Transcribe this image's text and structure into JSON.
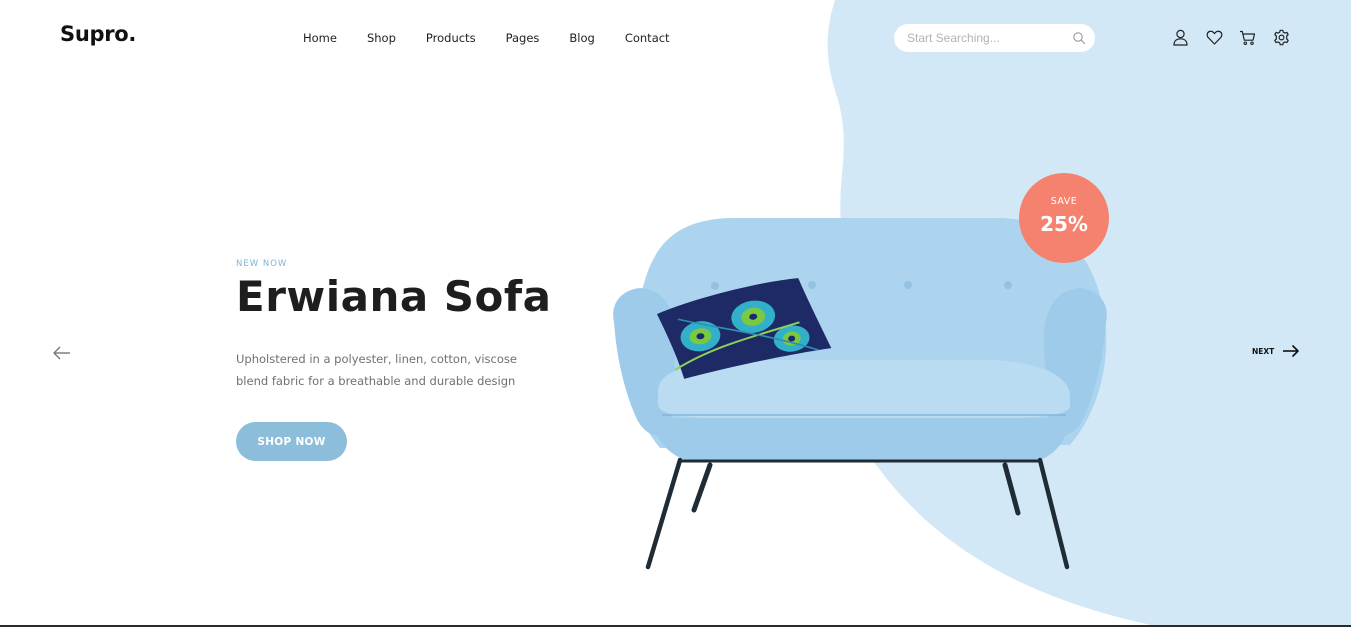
{
  "brand": {
    "logo": "Supro."
  },
  "nav": [
    "Home",
    "Shop",
    "Products",
    "Pages",
    "Blog",
    "Contact"
  ],
  "search": {
    "placeholder": "Start Searching...",
    "icon": "search-icon"
  },
  "header_icons": [
    "user-icon",
    "heart-icon",
    "cart-icon",
    "settings-gear-icon"
  ],
  "hero": {
    "kicker": "NEW NOW",
    "title": "Erwiana Sofa",
    "description": "Upholstered in a polyester, linen, cotton, viscose blend fabric for a breathable and durable design",
    "cta_label": "SHOP NOW"
  },
  "badge": {
    "label": "SAVE",
    "value": "25%"
  },
  "slider": {
    "prev_icon": "arrow-left-icon",
    "next_label": "NEXT",
    "next_icon": "arrow-right-icon"
  },
  "colors": {
    "blob": "#d3e8f7",
    "accent": "#8cbedc",
    "badge": "#f4826e",
    "sofa": "#a9d2ee"
  }
}
